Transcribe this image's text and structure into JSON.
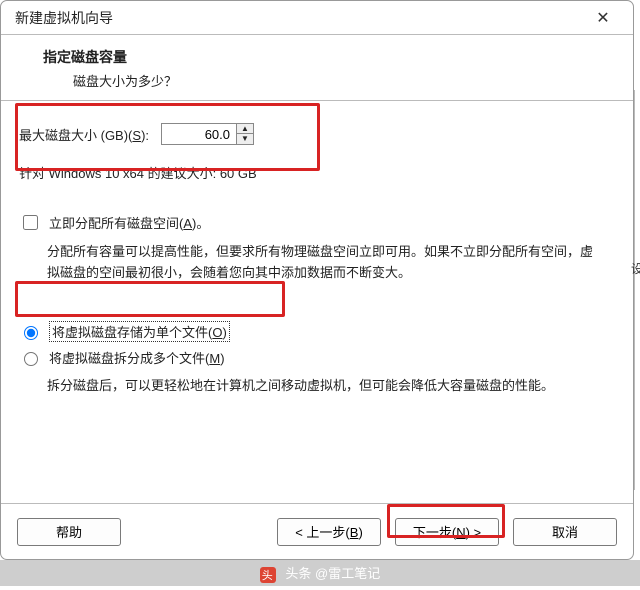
{
  "window": {
    "title": "新建虚拟机向导"
  },
  "header": {
    "title": "指定磁盘容量",
    "subtitle": "磁盘大小为多少？"
  },
  "size": {
    "label_pre": "最大磁盘大小 (GB)(",
    "label_accel": "S",
    "label_post": "):",
    "value": "60.0",
    "recommended": "针对 Windows 10 x64 的建议大小: 60 GB"
  },
  "allocate": {
    "label_pre": "立即分配所有磁盘空间(",
    "label_accel": "A",
    "label_post": ")。",
    "checked": false,
    "desc": "分配所有容量可以提高性能，但要求所有物理磁盘空间立即可用。如果不立即分配所有空间，虚拟磁盘的空间最初很小，会随着您向其中添加数据而不断变大。"
  },
  "storage": {
    "single": {
      "label_pre": "将虚拟磁盘存储为单个文件(",
      "label_accel": "O",
      "label_post": ")",
      "selected": true
    },
    "split": {
      "label_pre": "将虚拟磁盘拆分成多个文件(",
      "label_accel": "M",
      "label_post": ")",
      "selected": false
    },
    "split_desc": "拆分磁盘后，可以更轻松地在计算机之间移动虚拟机，但可能会降低大容量磁盘的性能。"
  },
  "buttons": {
    "help": "帮助",
    "back_pre": "< 上一步(",
    "back_accel": "B",
    "back_post": ")",
    "next_pre": "下一步(",
    "next_accel": "N",
    "next_post": ") >",
    "cancel": "取消"
  },
  "watermark": "头条 @雷工笔记",
  "peeking_char": "设"
}
